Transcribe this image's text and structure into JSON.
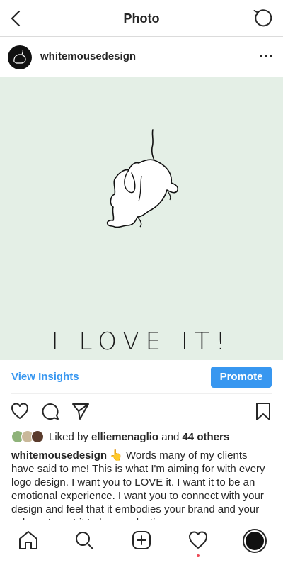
{
  "header": {
    "title": "Photo"
  },
  "post": {
    "username": "whitemousedesign",
    "image_text": "I LOVE IT!",
    "view_insights": "View Insights",
    "promote": "Promote",
    "likes_prefix": "Liked by ",
    "likes_user": "elliemenaglio",
    "likes_and": " and ",
    "likes_others": "44 others",
    "caption_username": "whitemousedesign",
    "caption_text": "👆 Words many of my clients have said to me! This is what I'm aiming for with every logo design. I want you to LOVE it. I want it to be an emotional experience. I want you to connect with your design and feel that it embodies your brand and your values. I want it to leave a lasting"
  },
  "icons": {
    "back": "chevron-left-icon",
    "refresh": "refresh-icon",
    "more": "more-horizontal-icon",
    "like": "heart-icon",
    "comment": "comment-icon",
    "share": "send-icon",
    "save": "bookmark-icon",
    "home": "home-icon",
    "search": "search-icon",
    "new_post": "plus-square-icon",
    "activity": "heart-icon",
    "profile": "profile-avatar"
  },
  "colors": {
    "accent": "#3897f0",
    "photo_background": "#e4efe6",
    "notification_dot": "#ed4956"
  }
}
